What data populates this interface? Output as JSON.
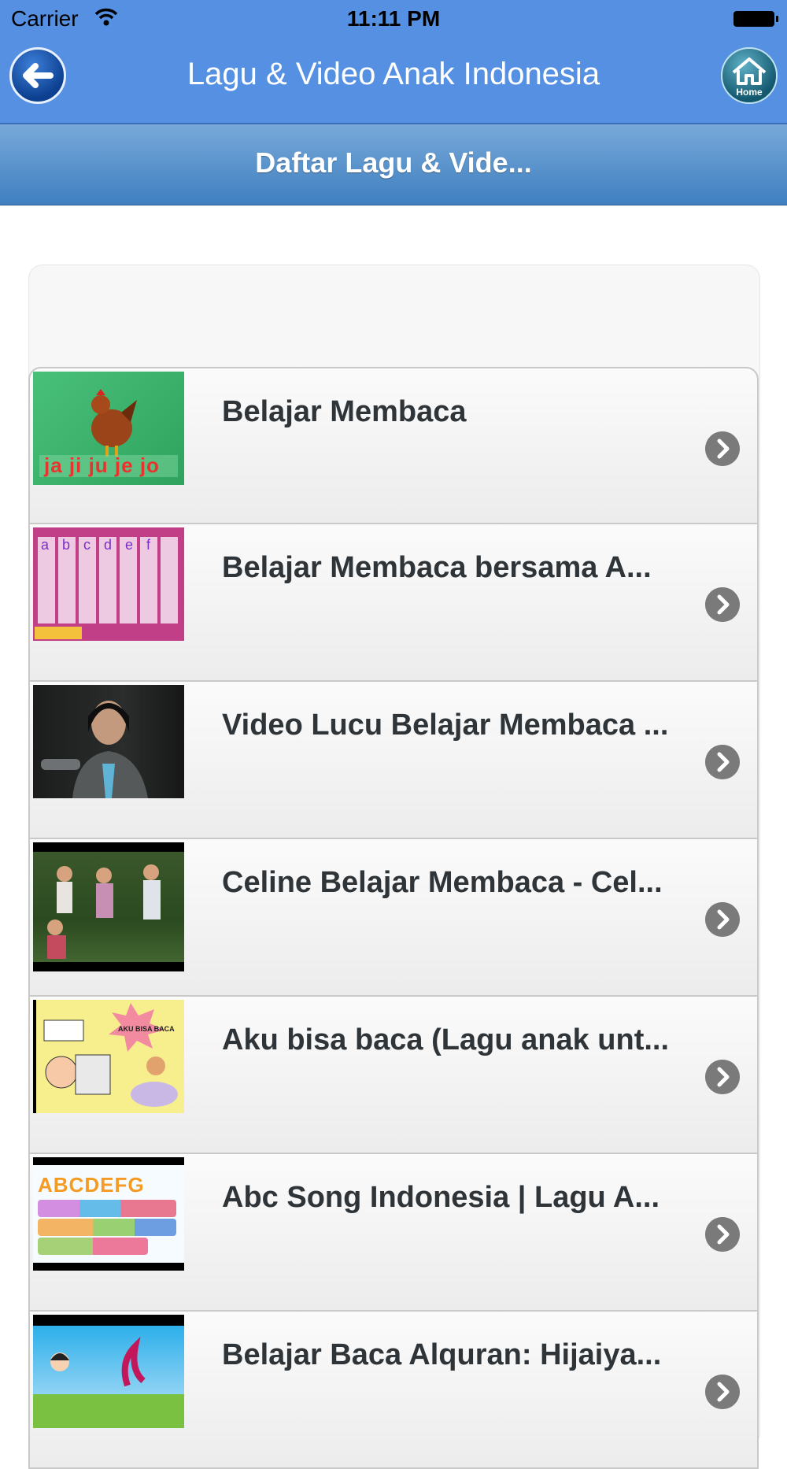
{
  "status_bar": {
    "carrier": "Carrier",
    "time": "11:11 PM"
  },
  "nav_bar": {
    "title": "Lagu & Video Anak Indonesia",
    "home_label": "Home"
  },
  "subheader": {
    "title": "Daftar Lagu & Vide..."
  },
  "colors": {
    "nav_blue": "#5590e3",
    "subheader_top": "#78a9d9",
    "subheader_bottom": "#3f7fc0",
    "title_text": "#2e3438"
  },
  "videos": [
    {
      "title": "Belajar Membaca",
      "thumb_text": "ja ji ju je jo"
    },
    {
      "title": "Belajar Membaca bersama A...",
      "thumb_text": "a b c d e f"
    },
    {
      "title": "Video Lucu Belajar Membaca ...",
      "thumb_text": ""
    },
    {
      "title": "Celine Belajar Membaca - Cel...",
      "thumb_text": ""
    },
    {
      "title": "Aku bisa baca (Lagu anak unt...",
      "thumb_text": "AKU BISA BACA"
    },
    {
      "title": "Abc Song Indonesia | Lagu A...",
      "thumb_text": "ABCDEFG"
    },
    {
      "title": "Belajar Baca Alquran: Hijaiya...",
      "thumb_text": ""
    }
  ]
}
